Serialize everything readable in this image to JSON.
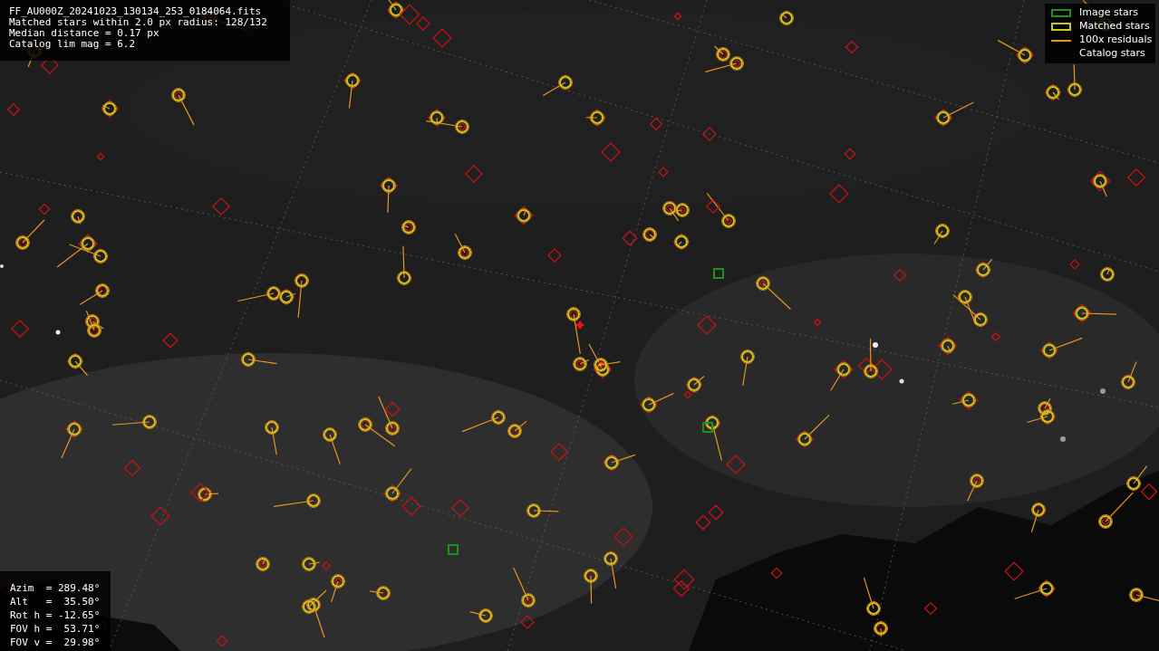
{
  "info_lines": [
    "FF_AU000Z_20241023_130134_253_0184064.fits",
    "Matched stars within 2.0 px radius: 128/132",
    "Median distance = 0.17 px",
    "Catalog lim mag = 6.2"
  ],
  "legend": [
    {
      "kind": "image",
      "label": "Image stars"
    },
    {
      "kind": "matched",
      "label": "Matched stars"
    },
    {
      "kind": "residual",
      "label": "100x residuals"
    },
    {
      "kind": "catalog",
      "label": "Catalog stars"
    }
  ],
  "pointing": [
    "Azim  = 289.48°",
    "Alt   =  35.50°",
    "Rot h = -12.65°",
    "FOV h =  53.71°",
    "FOV v =  29.98°"
  ]
}
